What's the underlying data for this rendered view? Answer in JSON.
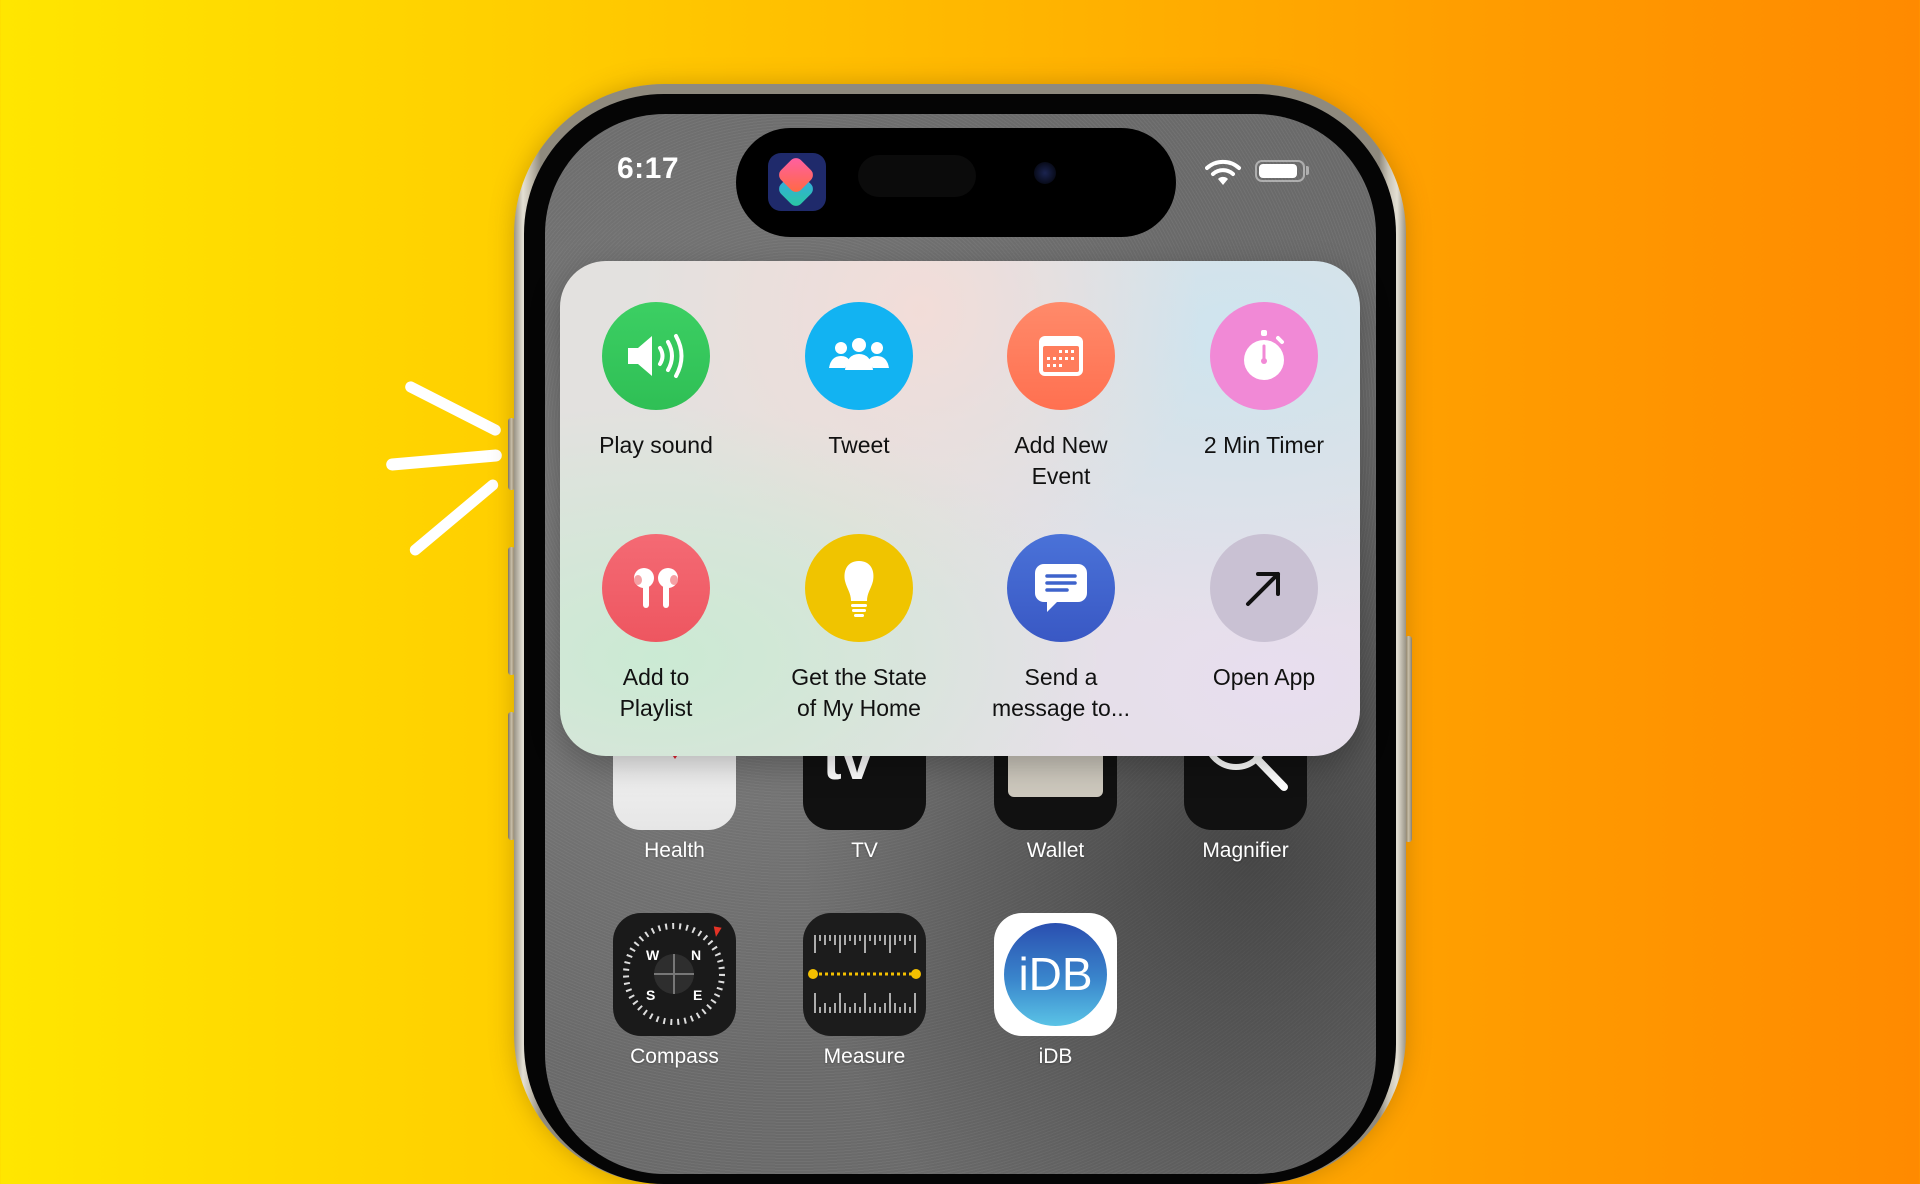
{
  "background": {
    "gradient_start": "#ffe600",
    "gradient_end": "#ff8a00"
  },
  "status_bar": {
    "time": "6:17",
    "dynamic_island_app": "shortcuts-icon",
    "wifi_icon": "wifi-icon",
    "battery_icon": "battery-icon"
  },
  "shortcuts_menu": {
    "actions": [
      {
        "label": "Play sound",
        "icon": "speaker-icon",
        "color": "#34c759"
      },
      {
        "label": "Tweet",
        "icon": "people-icon",
        "color": "#12b3f2"
      },
      {
        "label": "Add New Event",
        "label_lines": [
          "Add New",
          "Event"
        ],
        "icon": "calendar-icon",
        "color": "#ff7d5c"
      },
      {
        "label": "2 Min Timer",
        "icon": "stopwatch-icon",
        "color": "#f189d6"
      },
      {
        "label": "Add to Playlist",
        "label_lines": [
          "Add to",
          "Playlist"
        ],
        "icon": "airpods-icon",
        "color": "#f25b66"
      },
      {
        "label": "Get the State of My Home",
        "label_lines": [
          "Get the State",
          "of My Home"
        ],
        "icon": "lightbulb-icon",
        "color": "#f0c400"
      },
      {
        "label": "Send a message to...",
        "label_lines": [
          "Send a",
          "message to..."
        ],
        "icon": "message-icon",
        "color": "#3e63cc"
      },
      {
        "label": "Open App",
        "icon": "arrow-up-right-icon",
        "color": "#c9c1d3"
      }
    ]
  },
  "home_apps": {
    "row1": [
      {
        "label": "Health",
        "icon": "health-icon"
      },
      {
        "label": "TV",
        "icon": "tv-icon"
      },
      {
        "label": "Wallet",
        "icon": "wallet-icon"
      },
      {
        "label": "Magnifier",
        "icon": "magnifier-icon"
      }
    ],
    "row2": [
      {
        "label": "Compass",
        "icon": "compass-icon",
        "letters": {
          "n": "N",
          "s": "S",
          "e": "E",
          "w": "W"
        }
      },
      {
        "label": "Measure",
        "icon": "measure-icon"
      },
      {
        "label": "iDB",
        "icon": "idb-icon",
        "text": "iDB"
      }
    ]
  },
  "menu_line_0": {
    "a": "Play sound"
  },
  "labels": {
    "a0": "Play sound",
    "a1": "Tweet",
    "a2_l1": "Add New",
    "a2_l2": "Event",
    "a3": "2 Min Timer",
    "a4_l1": "Add to",
    "a4_l2": "Playlist",
    "a5_l1": "Get the State",
    "a5_l2": "of My Home",
    "a6_l1": "Send a",
    "a6_l2": "message to...",
    "a7": "Open App"
  }
}
